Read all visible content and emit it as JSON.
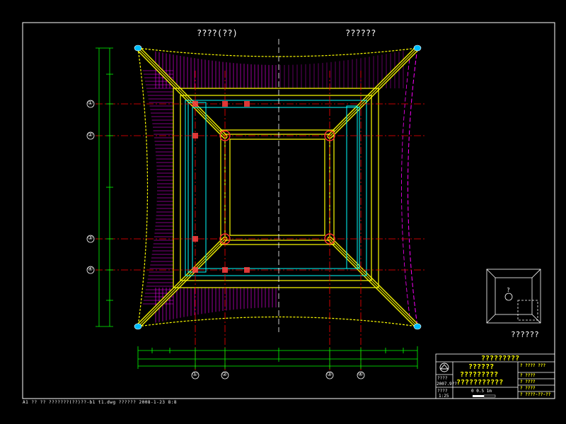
{
  "plan": {
    "left_title": "????(??)",
    "right_title": "??????",
    "key_label": "??????",
    "key_marker": "?"
  },
  "axes": {
    "left_bubbles": [
      "①",
      "②",
      "③",
      "④"
    ],
    "bottom_bubbles": [
      "①",
      "②",
      "③",
      "④"
    ]
  },
  "title_block": {
    "project": "?????????",
    "line1": "??????",
    "line2": "?????????",
    "line3": "???????????",
    "date_label": "????",
    "date": "2007.9??",
    "scale_label": "????",
    "scale": "1:25",
    "scalebar": "0   0.5   1m",
    "row1": "? ???? ???",
    "row2": "? ????",
    "row3": "? ????",
    "row4": "? ????",
    "row5": "? ????",
    "drawing_no": "? ????-??-??"
  },
  "status_bar": "A1 ??   ??  ???????(??)??-b1 t1.dwg    ??????  2008-1-23 8:8",
  "colors": {
    "bg": "#000000",
    "yellow": "#ffff00",
    "cyan": "#00ffff",
    "magenta": "#ff00ff",
    "red": "#ff0000",
    "white": "#ffffff",
    "green": "#00ff00"
  }
}
